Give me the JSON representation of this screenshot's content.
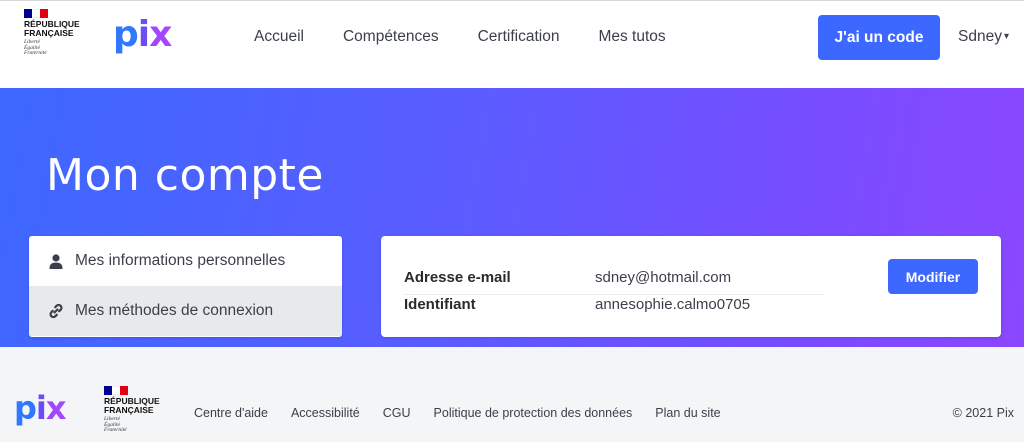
{
  "header": {
    "republic": [
      "RÉPUBLIQUE",
      "FRANÇAISE"
    ],
    "motto": [
      "Liberté",
      "Égalité",
      "Fraternité"
    ],
    "logo": "pix",
    "nav": [
      "Accueil",
      "Compétences",
      "Certification",
      "Mes tutos"
    ],
    "code_button": "J'ai un code",
    "user": "Sdney",
    "flag_colors": [
      "#000091",
      "#ffffff",
      "#e1000f"
    ]
  },
  "hero": {
    "title": "Mon compte",
    "menu": [
      {
        "label": "Mes informations personnelles",
        "icon": "user-icon",
        "active": false
      },
      {
        "label": "Mes méthodes de connexion",
        "icon": "link-icon",
        "active": true
      }
    ]
  },
  "account": {
    "email_label": "Adresse e-mail",
    "email_value": "sdney@hotmail.com",
    "id_label": "Identifiant",
    "id_value": "annesophie.calmo0705",
    "modify_button": "Modifier"
  },
  "footer": {
    "logo": "pix",
    "republic": [
      "RÉPUBLIQUE",
      "FRANÇAISE"
    ],
    "motto": [
      "Liberté",
      "Égalité",
      "Fraternité"
    ],
    "links": [
      "Centre d'aide",
      "Accessibilité",
      "CGU",
      "Politique de protection des données",
      "Plan du site"
    ],
    "copyright": "© 2021 Pix"
  },
  "colors": {
    "primary": "#3d68ff",
    "gradient_end": "#8b47ff"
  }
}
